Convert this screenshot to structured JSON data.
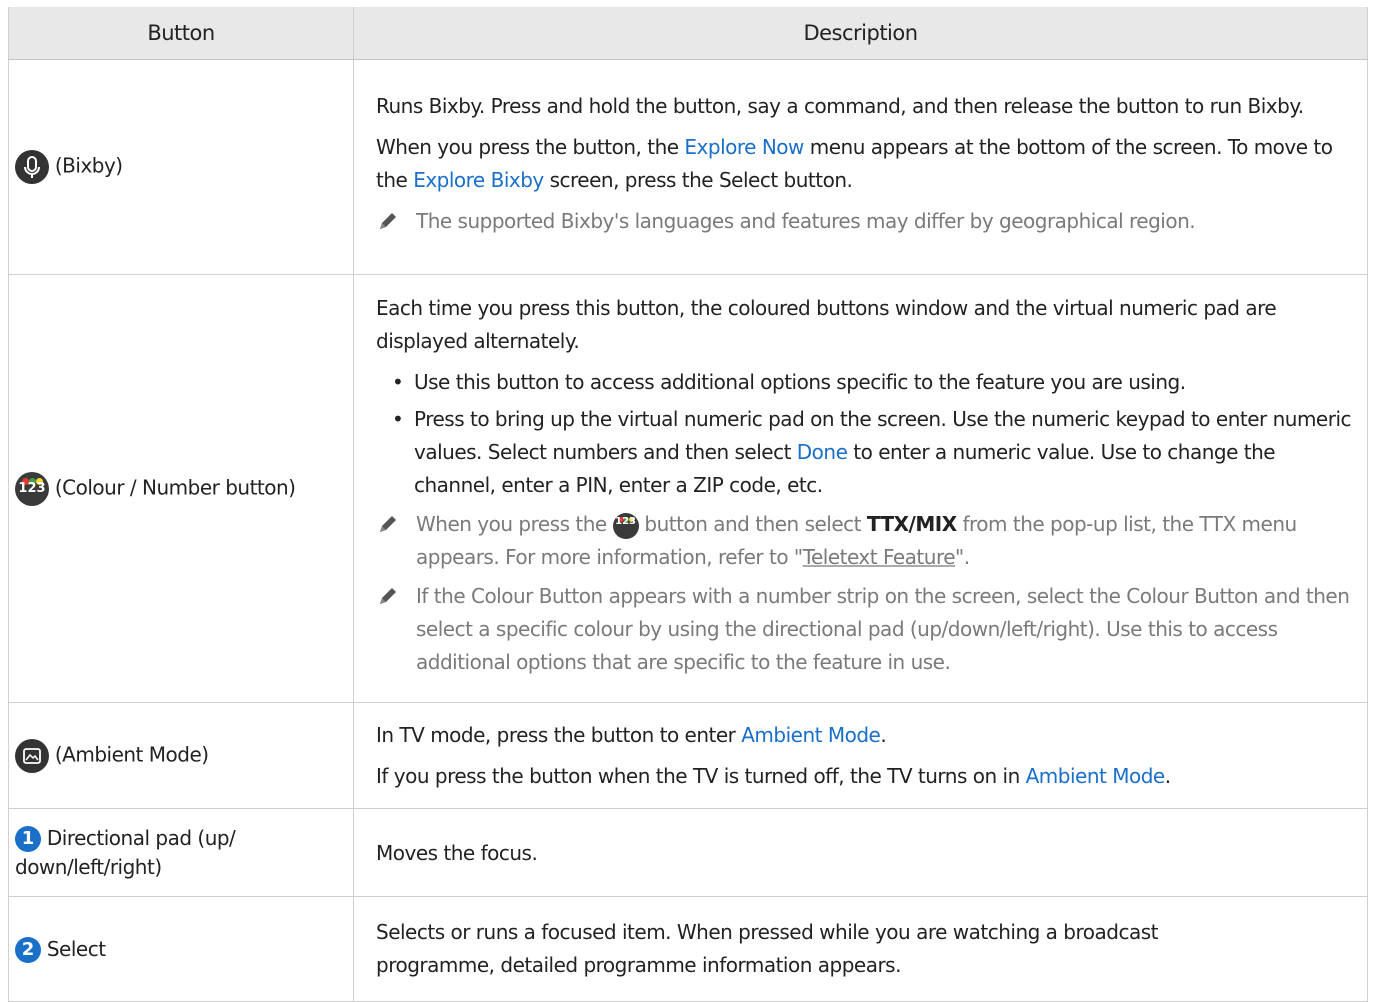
{
  "table": {
    "headers": {
      "button": "Button",
      "description": "Description"
    },
    "rows": {
      "bixby": {
        "button_label": "(Bixby)",
        "icon": "microphone-icon",
        "p1": "Runs Bixby. Press and hold the button, say a command, and then release the button to run Bixby.",
        "p2_a": "When you press the button, the ",
        "p2_link1": "Explore Now",
        "p2_b": " menu appears at the bottom of the screen. To move to the ",
        "p2_link2": "Explore Bixby",
        "p2_c": " screen, press the Select button.",
        "note": "The supported Bixby's languages and features may differ by geographical region."
      },
      "colour_number": {
        "button_label": "(Colour / Number button)",
        "icon": "colour-number-icon",
        "icon_text": "123",
        "p1": "Each time you press this button, the coloured buttons window and the virtual numeric pad are displayed alternately.",
        "bullet1": "Use this button to access additional options specific to the feature you are using.",
        "bullet2_a": "Press to bring up the virtual numeric pad on the screen. Use the numeric keypad to enter numeric values. Select numbers and then select ",
        "bullet2_link": "Done",
        "bullet2_b": " to enter a numeric value. Use to change the channel, enter a PIN, enter a ZIP code, etc.",
        "note1_a": "When you press the ",
        "note1_b": " button and then select ",
        "note1_bold": "TTX/MIX",
        "note1_c": " from the pop-up list, the TTX menu appears. For more information, refer to \"",
        "note1_link": "Teletext Feature",
        "note1_d": "\".",
        "note2": "If the Colour Button appears with a number strip on the screen, select the Colour Button and then select a specific colour by using the directional pad (up/down/left/right). Use this to access additional options that are specific to the feature in use."
      },
      "ambient": {
        "button_label": "(Ambient Mode)",
        "icon": "ambient-mode-icon",
        "p1_a": "In TV mode, press the button to enter ",
        "p1_link": "Ambient Mode",
        "p1_b": ".",
        "p2_a": "If you press the button when the TV is turned off, the TV turns on in ",
        "p2_link": "Ambient Mode",
        "p2_b": "."
      },
      "directional": {
        "number": "1",
        "button_label": "Directional pad (up/ down/left/right)",
        "description": "Moves the focus."
      },
      "select": {
        "number": "2",
        "button_label": "Select",
        "description": "Selects or runs a focused item. When pressed while you are watching a broadcast programme, detailed programme information appears."
      }
    }
  },
  "colors": {
    "link": "#1a6fc9",
    "header_bg": "#e8e8e8",
    "note_text": "#7a7a7a",
    "dot_red": "#e53935",
    "dot_green": "#43a047",
    "dot_yellow": "#fdd835"
  }
}
